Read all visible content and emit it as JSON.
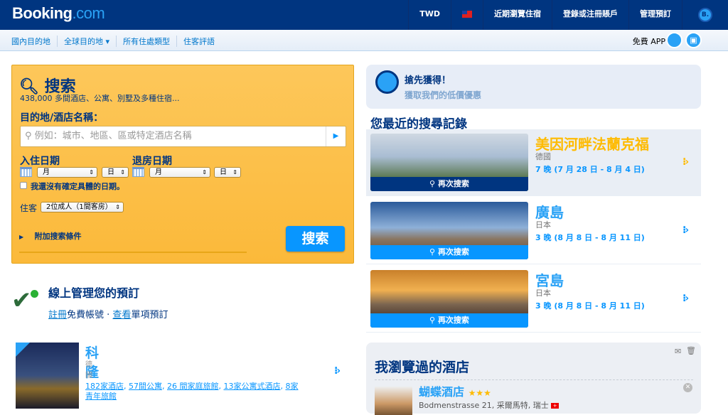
{
  "header": {
    "logo": "Booking",
    "logo_suffix": ".com",
    "currency": "TWD",
    "recent": "近期瀏覽住宿",
    "login": "登錄或注冊賬戶",
    "manage": "管理預訂",
    "pin": "B."
  },
  "subnav": {
    "items": [
      "國內目的地",
      "全球目的地 ▾",
      "所有住處類型",
      "住客評語"
    ],
    "app": "免費 APP"
  },
  "search": {
    "title": "搜索",
    "count": "438,000 多間酒店、公寓、別墅及多種住宿...",
    "dest_label": "目的地/酒店名稱：",
    "dest_placeholder": "例如：城市、地區、區或特定酒店名稱",
    "checkin": "入住日期",
    "checkout": "退房日期",
    "month": "月",
    "day": "日",
    "no_dates": "我還沒有確定具體的日期。",
    "guests_label": "住客",
    "guests": "2位成人（1間客房）",
    "more": "附加搜索條件",
    "button": "搜索"
  },
  "manage": {
    "title": "線上管理您的預訂",
    "register": "註冊",
    "free": "免費帳號 · ",
    "view": "查看",
    "single": "單項預訂"
  },
  "city": {
    "name": "科隆",
    "country": "德國",
    "links": [
      "182家酒店",
      "57間公寓",
      "26 間家庭旅館",
      "13家公寓式酒店",
      "8家青年旅館"
    ]
  },
  "deal": {
    "title": "搶先獲得！",
    "sub": "獲取我們的低價優惠"
  },
  "recent": {
    "title": "您最近的搜尋記錄",
    "again": "再次搜索",
    "items": [
      {
        "name": "美因河畔法蘭克福",
        "country": "德國",
        "dates": "7 晚 (7 月 28 日 - 8 月 4 日)"
      },
      {
        "name": "廣島",
        "country": "日本",
        "dates": "3 晚 (8 月 8 日 - 8 月 11 日)"
      },
      {
        "name": "宮島",
        "country": "日本",
        "dates": "3 晚 (8 月 8 日 - 8 月 11 日)"
      }
    ]
  },
  "viewed": {
    "title": "我瀏覽過的酒店",
    "hotel": "蝴蝶酒店",
    "stars": "★★★",
    "address": "Bodmenstrasse 21, 采爾馬特, 瑞士"
  }
}
